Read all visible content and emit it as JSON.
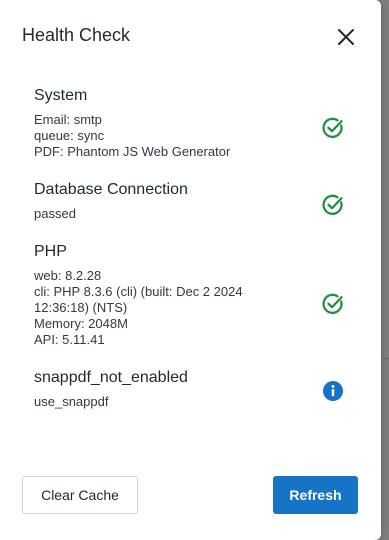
{
  "dialog": {
    "title": "Health Check",
    "close_icon": "close-icon"
  },
  "colors": {
    "success": "#1e8e3e",
    "info": "#1773c6",
    "primary_button": "#1773c6"
  },
  "checks": [
    {
      "title": "System",
      "lines": [
        "Email: smtp",
        "queue: sync",
        "PDF: Phantom JS Web Generator"
      ],
      "status": "passed",
      "icon": "check-circle-icon"
    },
    {
      "title": "Database Connection",
      "lines": [
        "passed"
      ],
      "status": "passed",
      "icon": "check-circle-icon"
    },
    {
      "title": "PHP",
      "lines": [
        "web: 8.2.28",
        "cli: PHP 8.3.6 (cli) (built: Dec 2 2024",
        "12:36:18) (NTS)",
        "Memory: 2048M",
        "API: 5.11.41"
      ],
      "status": "passed",
      "icon": "check-circle-icon"
    },
    {
      "title": "snappdf_not_enabled",
      "lines": [
        "use_snappdf"
      ],
      "status": "info",
      "icon": "info-icon"
    }
  ],
  "footer": {
    "clear_cache_label": "Clear Cache",
    "refresh_label": "Refresh"
  }
}
